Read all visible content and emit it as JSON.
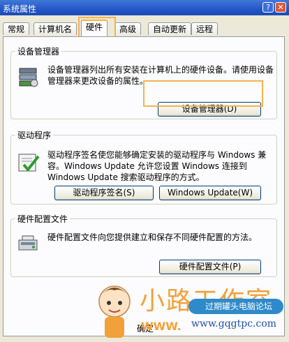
{
  "window": {
    "title": "系统属性",
    "help_glyph": "?",
    "close_glyph": "✕"
  },
  "tabs": [
    {
      "label": "常规"
    },
    {
      "label": "计算机名"
    },
    {
      "label": "硬件",
      "active": true
    },
    {
      "label": "高级"
    },
    {
      "label": "自动更新"
    },
    {
      "label": "远程"
    }
  ],
  "device_manager": {
    "legend": "设备管理器",
    "description": "设备管理器列出所有安装在计算机上的硬件设备。请使用设备管理器来更改设备的属性。",
    "button_label": "设备管理器(D)",
    "icon": "device-manager-icon"
  },
  "drivers": {
    "legend": "驱动程序",
    "description": "驱动程序签名使您能够确定安装的驱动程序与 Windows 兼容。Windows Update 允许您设置 Windows 连接到 Windows Update 搜索驱动程序的方式。",
    "signing_button_label": "驱动程序签名(S)",
    "update_button_label": "Windows Update(W)",
    "icon": "driver-signing-icon"
  },
  "hardware_profiles": {
    "legend": "硬件配置文件",
    "description": "硬件配置文件向您提供建立和保存不同硬件配置的方法。",
    "button_label": "硬件配置文件(P)",
    "icon": "hardware-profile-icon"
  },
  "watermark": {
    "brand": "小路工作室",
    "badge": "过期罐头电脑论坛",
    "www": "WWW.",
    "url": "www.gqgtpc.com",
    "partial_text": "确定"
  },
  "colors": {
    "highlight": "#f6b24f",
    "titlebar": "#2457c6",
    "brand": "#f2a03a"
  }
}
